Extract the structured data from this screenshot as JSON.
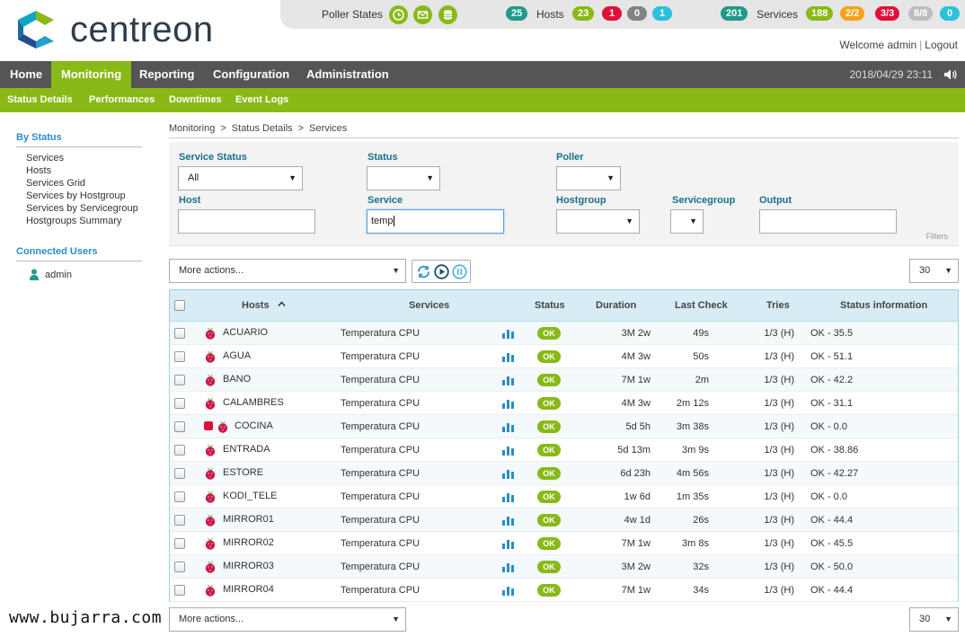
{
  "brand": {
    "name": "centreon"
  },
  "topbar": {
    "poller_label": "Poller States",
    "hosts_label": "Hosts",
    "services_label": "Services",
    "hosts_counts": [
      {
        "value": "25",
        "color": "#1f9a8b"
      },
      {
        "value": "23",
        "color": "#88b917"
      },
      {
        "value": "1",
        "color": "#e0103a"
      },
      {
        "value": "0",
        "color": "#818285"
      },
      {
        "value": "1",
        "color": "#2ac1dc"
      }
    ],
    "services_counts": [
      {
        "value": "201",
        "color": "#1f9a8b"
      },
      {
        "value": "188",
        "color": "#88b917"
      },
      {
        "value": "2/2",
        "color": "#f6a31b"
      },
      {
        "value": "3/3",
        "color": "#e0103a"
      },
      {
        "value": "8/8",
        "color": "#bcbdc0"
      },
      {
        "value": "0",
        "color": "#2ac1dc"
      }
    ],
    "welcome": "Welcome admin",
    "logout": "Logout"
  },
  "mainnav": {
    "items": [
      "Home",
      "Monitoring",
      "Reporting",
      "Configuration",
      "Administration"
    ],
    "active": "Monitoring",
    "datetime": "2018/04/29 23:11"
  },
  "subnav": {
    "items": [
      "Status  Details",
      "Performances",
      "Downtimes",
      "Event  Logs"
    ]
  },
  "sidebar": {
    "by_status_title": "By Status",
    "links": [
      "Services",
      "Hosts",
      "Services Grid",
      "Services by Hostgroup",
      "Services by Servicegroup",
      "Hostgroups Summary"
    ],
    "connected_title": "Connected Users",
    "users": [
      "admin"
    ]
  },
  "breadcrumb": [
    "Monitoring",
    "Status Details",
    "Services"
  ],
  "filters": {
    "service_status_label": "Service Status",
    "service_status_value": "All",
    "status_label": "Status",
    "status_value": "",
    "poller_label": "Poller",
    "poller_value": "",
    "host_label": "Host",
    "host_value": "",
    "service_label": "Service",
    "service_value": "temp",
    "hostgroup_label": "Hostgroup",
    "hostgroup_value": "",
    "servicegroup_label": "Servicegroup",
    "servicegroup_value": "",
    "output_label": "Output",
    "output_value": "",
    "filters_link": "Filters"
  },
  "actions": {
    "more_actions": "More actions...",
    "limit": "30"
  },
  "table": {
    "headers": [
      "Hosts",
      "Services",
      "Status",
      "Duration",
      "Last Check",
      "Tries",
      "Status information"
    ],
    "rows": [
      {
        "host": "ACUARIO",
        "service": "Temperatura CPU",
        "status": "OK",
        "duration": "3M 2w",
        "last_check": "49s",
        "tries": "1/3 (H)",
        "info": "OK - 35.5",
        "down": false
      },
      {
        "host": "AGUA",
        "service": "Temperatura CPU",
        "status": "OK",
        "duration": "4M 3w",
        "last_check": "50s",
        "tries": "1/3 (H)",
        "info": "OK - 51.1",
        "down": false
      },
      {
        "host": "BANO",
        "service": "Temperatura CPU",
        "status": "OK",
        "duration": "7M 1w",
        "last_check": "2m",
        "tries": "1/3 (H)",
        "info": "OK - 42.2",
        "down": false
      },
      {
        "host": "CALAMBRES",
        "service": "Temperatura CPU",
        "status": "OK",
        "duration": "4M 3w",
        "last_check": "2m 12s",
        "tries": "1/3 (H)",
        "info": "OK - 31.1",
        "down": false
      },
      {
        "host": "COCINA",
        "service": "Temperatura CPU",
        "status": "OK",
        "duration": "5d 5h",
        "last_check": "3m 38s",
        "tries": "1/3 (H)",
        "info": "OK - 0.0",
        "down": true
      },
      {
        "host": "ENTRADA",
        "service": "Temperatura CPU",
        "status": "OK",
        "duration": "5d 13m",
        "last_check": "3m 9s",
        "tries": "1/3 (H)",
        "info": "OK - 38.86",
        "down": false
      },
      {
        "host": "ESTORE",
        "service": "Temperatura CPU",
        "status": "OK",
        "duration": "6d 23h",
        "last_check": "4m 56s",
        "tries": "1/3 (H)",
        "info": "OK - 42.27",
        "down": false
      },
      {
        "host": "KODI_TELE",
        "service": "Temperatura CPU",
        "status": "OK",
        "duration": "1w 6d",
        "last_check": "1m 35s",
        "tries": "1/3 (H)",
        "info": "OK - 0.0",
        "down": false
      },
      {
        "host": "MIRROR01",
        "service": "Temperatura CPU",
        "status": "OK",
        "duration": "4w 1d",
        "last_check": "26s",
        "tries": "1/3 (H)",
        "info": "OK - 44.4",
        "down": false
      },
      {
        "host": "MIRROR02",
        "service": "Temperatura CPU",
        "status": "OK",
        "duration": "7M 1w",
        "last_check": "3m 8s",
        "tries": "1/3 (H)",
        "info": "OK - 45.5",
        "down": false
      },
      {
        "host": "MIRROR03",
        "service": "Temperatura CPU",
        "status": "OK",
        "duration": "3M 2w",
        "last_check": "32s",
        "tries": "1/3 (H)",
        "info": "OK - 50.0",
        "down": false
      },
      {
        "host": "MIRROR04",
        "service": "Temperatura CPU",
        "status": "OK",
        "duration": "7M 1w",
        "last_check": "34s",
        "tries": "1/3 (H)",
        "info": "OK - 44.4",
        "down": false
      }
    ]
  },
  "watermark": "www.bujarra.com",
  "colors": {
    "accent_green": "#88b917",
    "nav_dark": "#555555",
    "link_blue": "#2a8dc5",
    "ok_green": "#88b917",
    "down_red": "#e0103a"
  }
}
